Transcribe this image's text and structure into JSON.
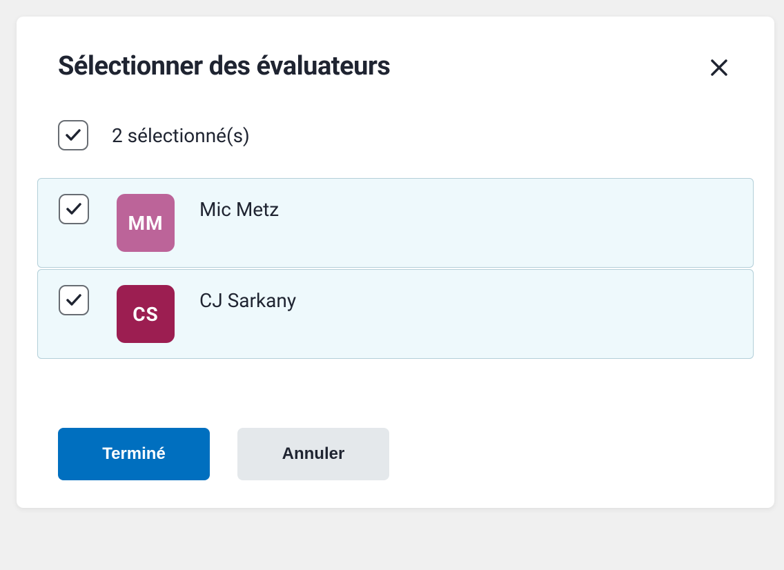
{
  "modal": {
    "title": "Sélectionner des évaluateurs",
    "selected_count_label": "2 sélectionné(s)",
    "evaluators": [
      {
        "initials": "MM",
        "name": "Mic Metz",
        "avatar_color": "#bc6499",
        "checked": true
      },
      {
        "initials": "CS",
        "name": "CJ Sarkany",
        "avatar_color": "#9c1e51",
        "checked": true
      }
    ],
    "footer": {
      "done_label": "Terminé",
      "cancel_label": "Annuler"
    }
  }
}
